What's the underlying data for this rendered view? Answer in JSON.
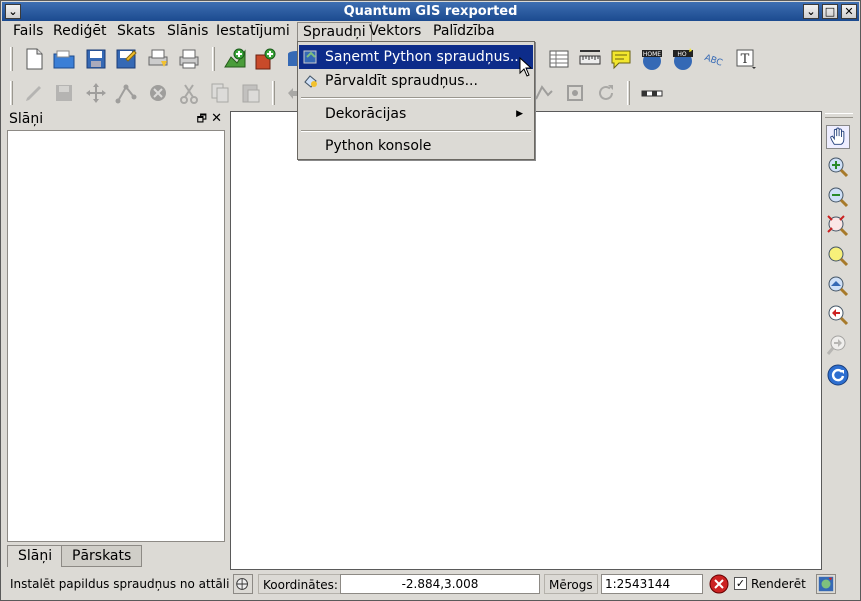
{
  "window": {
    "title": "Quantum GIS rexported"
  },
  "menubar": {
    "items": [
      "Fails",
      "Rediģēt",
      "Skats",
      "Slānis",
      "Iestatījumi",
      "Spraudņi",
      "Vektors",
      "Palīdzība"
    ]
  },
  "plugins_menu": {
    "items": [
      {
        "label": "Saņemt Python spraudņus...",
        "icon": "python-plugin-icon"
      },
      {
        "label": "Pārvaldīt spraudņus...",
        "icon": "plugin-manager-icon"
      },
      {
        "label": "Dekorācijas",
        "submenu": true
      },
      {
        "label": "Python konsole"
      }
    ]
  },
  "dock": {
    "title": "Slāņi",
    "tabs": [
      "Slāņi",
      "Pārskats"
    ]
  },
  "status": {
    "message": "Instalēt papildus spraudņus no attālināta",
    "coords_label": "Koordinātes:",
    "coords_value": "-2.884,3.008",
    "scale_label": "Mērogs",
    "scale_value": "1:2543144",
    "render_label": "Renderēt"
  },
  "colors": {
    "menu_highlight": "#0d2c8a",
    "titlebar": "#1b4a8f"
  }
}
